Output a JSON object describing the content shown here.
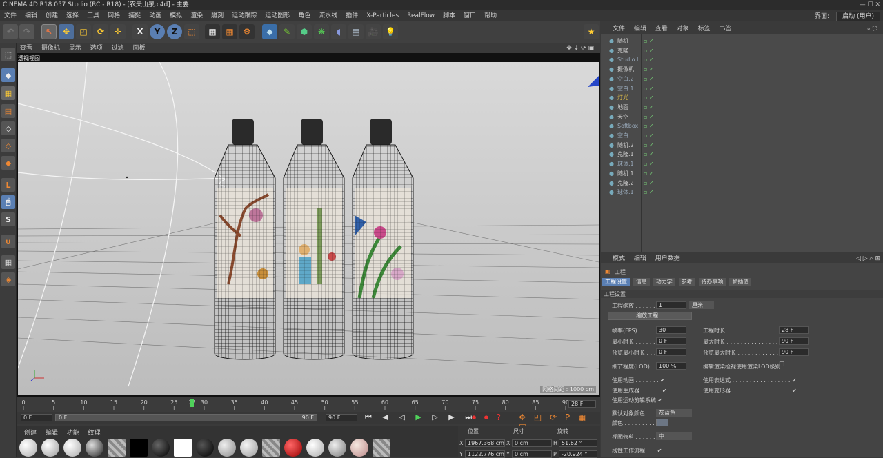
{
  "title_bar": {
    "text": "CINEMA 4D R18.057 Studio (RC - R18) - [农夫山泉.c4d] - 主要",
    "right_text": ""
  },
  "menu": {
    "items": [
      "文件",
      "编辑",
      "创建",
      "选择",
      "工具",
      "网格",
      "捕捉",
      "动画",
      "模拟",
      "渲染",
      "雕刻",
      "运动跟踪",
      "运动图形",
      "角色",
      "流水线",
      "插件",
      "X-Particles",
      "RealFlow",
      "脚本",
      "窗口",
      "帮助"
    ],
    "interface_label": "界面:",
    "interface_value": "启动 (用户)"
  },
  "viewport": {
    "menu": [
      "查看",
      "摄像机",
      "显示",
      "选项",
      "过滤",
      "面板"
    ],
    "label": "透视视图",
    "grid_info": "网格间距 : 1000 cm"
  },
  "timeline": {
    "ticks": [
      "0",
      "5",
      "10",
      "15",
      "20",
      "25",
      "28",
      "30",
      "35",
      "40",
      "45",
      "50",
      "55",
      "60",
      "65",
      "70",
      "75",
      "80",
      "85",
      "90"
    ],
    "current_frame": "28",
    "end_field": "28 F",
    "start_field": "0 F",
    "range_start": "0 F",
    "range_end": "90 F",
    "max_field": "90 F"
  },
  "materials": {
    "menu": [
      "创建",
      "编辑",
      "功能",
      "纹理"
    ]
  },
  "coords": {
    "headers": [
      "位置",
      "尺寸",
      "旋转"
    ],
    "row1": [
      "X",
      "1967.368 cm",
      "X",
      "0 cm",
      "H",
      "51.62 °"
    ],
    "row2": [
      "Y",
      "1122.776 cm",
      "Y",
      "0 cm",
      "P",
      "-20.924 °"
    ]
  },
  "object_manager": {
    "menu": [
      "文件",
      "编辑",
      "查看",
      "对象",
      "标签",
      "书签"
    ],
    "objects": [
      {
        "name": "随机",
        "color": "#cfcfcf"
      },
      {
        "name": "克隆",
        "color": "#cfcfcf"
      },
      {
        "name": "Studio L",
        "color": "#9ab"
      },
      {
        "name": "摄像机",
        "color": "#cfcfcf"
      },
      {
        "name": "空白.2",
        "color": "#9ab"
      },
      {
        "name": "空白.1",
        "color": "#9ab"
      },
      {
        "name": "灯光",
        "color": "#e6c34a"
      },
      {
        "name": "地面",
        "color": "#cfcfcf"
      },
      {
        "name": "天空",
        "color": "#cfcfcf"
      },
      {
        "name": "Softbox",
        "color": "#9ab"
      },
      {
        "name": "空白",
        "color": "#9ab"
      },
      {
        "name": "随机.2",
        "color": "#cfcfcf"
      },
      {
        "name": "克隆.1",
        "color": "#cfcfcf"
      },
      {
        "name": "球体.1",
        "color": "#9ab"
      },
      {
        "name": "随机.1",
        "color": "#cfcfcf"
      },
      {
        "name": "克隆.2",
        "color": "#cfcfcf"
      },
      {
        "name": "球体.1",
        "color": "#9ab"
      }
    ]
  },
  "attributes": {
    "menu": [
      "模式",
      "编辑",
      "用户数据"
    ],
    "section": "工程",
    "tabs": [
      "工程设置",
      "信息",
      "动力学",
      "参考",
      "待办事项",
      "帧插值"
    ],
    "group_title": "工程设置",
    "scale_label": "工程缩放 . . . . . . . .",
    "scale_value": "1",
    "scale_unit": "厘米",
    "scale_button": "缩放工程...",
    "fps_label": "帧率(FPS) . . . . . . . .",
    "fps_value": "30",
    "duration_label": "工程时长 . . . . . . . . . . . . . . . . . .",
    "duration_value": "28 F",
    "min_label": "最小时长 . . . . . . . .",
    "min_value": "0 F",
    "max_label": "最大时长 . . . . . . . . . . . . . . . . . .",
    "max_value": "90 F",
    "pmin_label": "预览最小时长 . . .",
    "pmin_value": "0 F",
    "pmax_label": "预览最大时长 . . . . . . . . . . . . . .",
    "pmax_value": "90 F",
    "lod_label": "细节程度(LOD)",
    "lod_value": "100 %",
    "lod_render_label": "编辑渲染检视使用渲染LOD级别",
    "use_anim": "使用动画 . . . . . . . ✔",
    "use_expr": "使用表达式 . . . . . . . . . . . . . . . . . ✔",
    "use_gen": "使用生成器 . . . . . . ✔",
    "use_deform": "使用变形器 . . . . . . . . . . . . . . . . . ✔",
    "use_motion": "使用运动剪辑系统 ✔",
    "default_color_label": "默认对象颜色 . . .",
    "default_color_value": "灰蓝色",
    "color_label": "颜色 . . . . . . . . . . . .",
    "view_clip_label": "视图修剪 . . . . . . .",
    "view_clip_value": "中",
    "linear_label": "线性工作流程 . . . ✔"
  },
  "colors": {
    "accent": "#5a7fb3",
    "viewport_bg": "#c8c8c8",
    "bottle": "#2a2a2a"
  }
}
